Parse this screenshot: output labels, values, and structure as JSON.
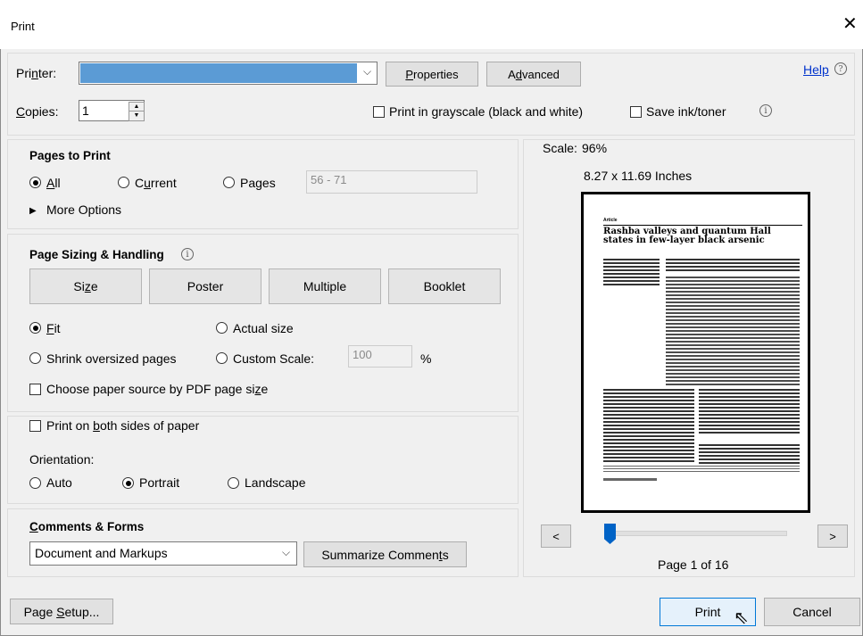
{
  "window": {
    "title": "Print"
  },
  "printer": {
    "label": "Printer:",
    "label_pre": "Pri",
    "label_u": "n",
    "label_post": "ter:",
    "properties_label": "Properties",
    "advanced_label": "Advanced",
    "help_label": "Help",
    "help_icon": "question-circle-icon",
    "selection_color": "#5b9bd5"
  },
  "copies": {
    "label": "Copies:",
    "value": "1",
    "grayscale_label": "Print in grayscale (black and white)",
    "save_ink_label": "Save ink/toner",
    "info_icon": "info-icon"
  },
  "pages_to_print": {
    "title": "Pages to Print",
    "all_label": "All",
    "current_label": "Current",
    "pages_label": "Pages",
    "pages_value": "56 - 71",
    "more_options_label": "More Options"
  },
  "sizing": {
    "title": "Page Sizing & Handling",
    "buttons": [
      "Size",
      "Poster",
      "Multiple",
      "Booklet"
    ],
    "fit_label": "Fit",
    "actual_size_label": "Actual size",
    "shrink_label": "Shrink oversized pages",
    "custom_scale_label": "Custom Scale:",
    "custom_scale_value": "100",
    "percent": "%",
    "paper_source_label": "Choose paper source by PDF page size"
  },
  "duplex": {
    "both_sides_label": "Print on both sides of paper",
    "orientation_label": "Orientation:",
    "auto_label": "Auto",
    "portrait_label": "Portrait",
    "landscape_label": "Landscape"
  },
  "comments": {
    "title": "Comments & Forms",
    "selected": "Document and Markups",
    "summarize_label": "Summarize Comments"
  },
  "preview": {
    "scale_label": "Scale:",
    "scale_value": "96%",
    "dimensions": "8.27 x 11.69 Inches",
    "article_tag": "Article",
    "article_title": "Rashba valleys and quantum Hall states in few-layer black arsenic",
    "page_info": "Page 1 of 16",
    "slider_fraction": 0.0,
    "prev_label": "<",
    "next_label": ">"
  },
  "footer": {
    "page_setup_label": "Page Setup...",
    "print_label": "Print",
    "cancel_label": "Cancel"
  }
}
